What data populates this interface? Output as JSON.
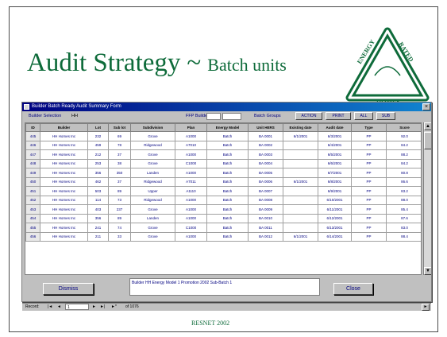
{
  "slide": {
    "title": "Audit Strategy",
    "separator": "~",
    "subtitle": "Batch units",
    "credit": "RESNET 2002"
  },
  "logo": {
    "words": [
      "ENERGY",
      "RATED",
      "HOMES"
    ]
  },
  "window": {
    "title": "Builder Batch Ready Audit Summary Form",
    "toolbar": {
      "builder_label": "Builder Selection",
      "builder_value": "HH",
      "filter_label": "FFP Builder",
      "filter_value_1": "",
      "filter_value_2": "",
      "batch_label": "Batch Groups",
      "buttons": [
        "ACTION",
        "PRINT",
        "ALL",
        "SUB"
      ]
    },
    "columns": [
      "ID",
      "Builder",
      "Lot",
      "Sub lot",
      "Subdivision",
      "Plan",
      "Energy Model",
      "Unit HERS",
      "Existing date",
      "Audit date",
      "Type",
      "Score"
    ],
    "rows": [
      [
        "445",
        "HH Homes Inc",
        "232",
        "69",
        "Grove",
        "A1000",
        "Batch",
        "BA 0001",
        "6/1/2001",
        "6/3/2001",
        "PP",
        "92.0"
      ],
      [
        "446",
        "HH Homes Inc",
        "459",
        "78",
        "Ridgewood",
        "A7010",
        "Batch",
        "BA 0002",
        "",
        "6/4/2001",
        "PP",
        "84.2"
      ],
      [
        "447",
        "HH Homes Inc",
        "212",
        "37",
        "Grove",
        "A1000",
        "Batch",
        "BA 0003",
        "",
        "6/5/2001",
        "PP",
        "88.2"
      ],
      [
        "448",
        "HH Homes Inc",
        "253",
        "38",
        "Grove",
        "C1000",
        "Batch",
        "BA 0004",
        "",
        "6/6/2001",
        "PP",
        "84.2"
      ],
      [
        "449",
        "HH Homes Inc",
        "356",
        "350",
        "Landen",
        "A1000",
        "Batch",
        "BA 0005",
        "",
        "6/7/2001",
        "PP",
        "80.8"
      ],
      [
        "450",
        "HH Homes Inc",
        "462",
        "37",
        "Ridgewood",
        "A7011",
        "Batch",
        "BA 0006",
        "6/1/2001",
        "6/8/2001",
        "PP",
        "86.6"
      ],
      [
        "451",
        "HH Homes Inc",
        "503",
        "89",
        "Upper",
        "A1110",
        "Batch",
        "BA 0007",
        "",
        "6/9/2001",
        "PP",
        "83.2"
      ],
      [
        "452",
        "HH Homes Inc",
        "114",
        "73",
        "Ridgewood",
        "A1000",
        "Batch",
        "BA 0008",
        "",
        "6/10/2001",
        "PP",
        "88.0"
      ],
      [
        "453",
        "HH Homes Inc",
        "403",
        "237",
        "Grove",
        "A1000",
        "Batch",
        "BA 0009",
        "",
        "6/11/2001",
        "PP",
        "85.4"
      ],
      [
        "454",
        "HH Homes Inc",
        "356",
        "89",
        "Landen",
        "A1000",
        "Batch",
        "BA 0010",
        "",
        "6/12/2001",
        "PP",
        "87.6"
      ],
      [
        "455",
        "HH Homes Inc",
        "241",
        "74",
        "Grove",
        "C1000",
        "Batch",
        "BA 0011",
        "",
        "6/13/2001",
        "PP",
        "83.0"
      ],
      [
        "456",
        "HH Homes Inc",
        "211",
        "33",
        "Grove",
        "A1000",
        "Batch",
        "BA 0012",
        "6/1/2001",
        "6/14/2001",
        "PP",
        "88.4"
      ]
    ],
    "footer": {
      "left_button": "Dismiss",
      "message": "Builder HH Energy Model 1 Promotion 2002 Sub-Batch 1",
      "right_button": "Close"
    },
    "nav": {
      "record_label": "Record:",
      "current": "1",
      "of_label": "of 1076"
    }
  }
}
